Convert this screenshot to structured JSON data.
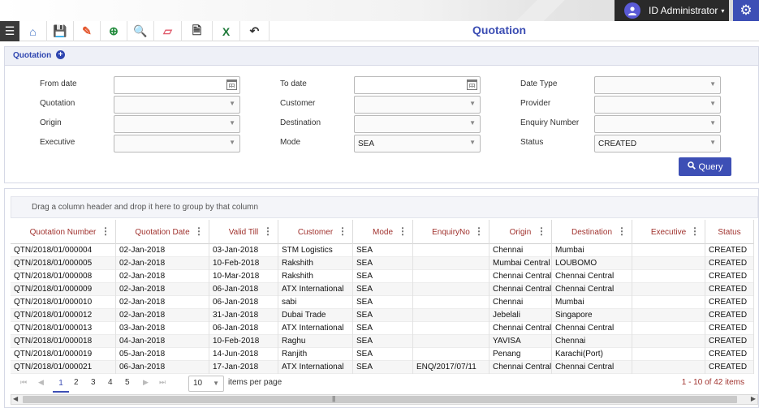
{
  "header": {
    "user_name": "ID Administrator",
    "user_caret": "▾",
    "user_avatar_icon": "user-avatar-icon",
    "settings_icon": "gear-icon"
  },
  "toolbar": {
    "menu_icon": "hamburger-menu-icon",
    "buttons": [
      {
        "icon": "home-icon",
        "glyph": "⌂",
        "color": "#3d6fc4"
      },
      {
        "icon": "save-icon",
        "glyph": "💾",
        "color": "#3d4fb5"
      },
      {
        "icon": "edit-icon",
        "glyph": "✎",
        "color": "#e4572e"
      },
      {
        "icon": "add-icon",
        "glyph": "⊕",
        "color": "#1f8a3a"
      },
      {
        "icon": "search-icon",
        "glyph": "🔍",
        "color": "#222222"
      },
      {
        "icon": "eraser-icon",
        "glyph": "▱",
        "color": "#e05a6b"
      },
      {
        "icon": "document-icon",
        "glyph": "🗎",
        "color": "#333333"
      },
      {
        "icon": "excel-icon",
        "glyph": "X",
        "color": "#1f7a3a"
      },
      {
        "icon": "undo-icon",
        "glyph": "↶",
        "color": "#333333"
      }
    ],
    "page_title": "Quotation"
  },
  "filter": {
    "section_title": "Quotation",
    "expand_glyph": "+",
    "fields": {
      "from_date_label": "From date",
      "to_date_label": "To date",
      "date_type_label": "Date Type",
      "quotation_label": "Quotation",
      "customer_label": "Customer",
      "provider_label": "Provider",
      "origin_label": "Origin",
      "destination_label": "Destination",
      "enquiry_number_label": "Enquiry Number",
      "executive_label": "Executive",
      "mode_label": "Mode",
      "mode_value": "SEA",
      "status_label": "Status",
      "status_value": "CREATED"
    },
    "query_button": "Query"
  },
  "grid": {
    "group_hint": "Drag a column header and drop it here to group by that column",
    "columns": [
      "Quotation Number",
      "Quotation Date",
      "Valid Till",
      "Customer",
      "Mode",
      "EnquiryNo",
      "Origin",
      "Destination",
      "Executive",
      "Status"
    ],
    "rows": [
      [
        "QTN/2018/01/000004",
        "02-Jan-2018",
        "03-Jan-2018",
        "STM Logistics",
        "SEA",
        "",
        "Chennai",
        "Mumbai",
        "",
        "CREATED"
      ],
      [
        "QTN/2018/01/000005",
        "02-Jan-2018",
        "10-Feb-2018",
        "Rakshith",
        "SEA",
        "",
        "Mumbai Central",
        "LOUBOMO",
        "",
        "CREATED"
      ],
      [
        "QTN/2018/01/000008",
        "02-Jan-2018",
        "10-Mar-2018",
        "Rakshith",
        "SEA",
        "",
        "Chennai Central",
        "Chennai Central",
        "",
        "CREATED"
      ],
      [
        "QTN/2018/01/000009",
        "02-Jan-2018",
        "06-Jan-2018",
        "ATX International",
        "SEA",
        "",
        "Chennai Central",
        "Chennai Central",
        "",
        "CREATED"
      ],
      [
        "QTN/2018/01/000010",
        "02-Jan-2018",
        "06-Jan-2018",
        "sabi",
        "SEA",
        "",
        "Chennai",
        "Mumbai",
        "",
        "CREATED"
      ],
      [
        "QTN/2018/01/000012",
        "02-Jan-2018",
        "31-Jan-2018",
        "Dubai Trade",
        "SEA",
        "",
        "Jebelali",
        "Singapore",
        "",
        "CREATED"
      ],
      [
        "QTN/2018/01/000013",
        "03-Jan-2018",
        "06-Jan-2018",
        "ATX International",
        "SEA",
        "",
        "Chennai Central",
        "Chennai Central",
        "",
        "CREATED"
      ],
      [
        "QTN/2018/01/000018",
        "04-Jan-2018",
        "10-Feb-2018",
        "Raghu",
        "SEA",
        "",
        "YAVISA",
        "Chennai",
        "",
        "CREATED"
      ],
      [
        "QTN/2018/01/000019",
        "05-Jan-2018",
        "14-Jun-2018",
        "Ranjith",
        "SEA",
        "",
        "Penang",
        "Karachi(Port)",
        "",
        "CREATED"
      ],
      [
        "QTN/2018/01/000021",
        "06-Jan-2018",
        "17-Jan-2018",
        "ATX International",
        "SEA",
        "ENQ/2017/07/11",
        "Chennai Central",
        "Chennai Central",
        "",
        "CREATED"
      ]
    ]
  },
  "pager": {
    "first": "⏮",
    "prev": "◀",
    "pages": [
      "1",
      "2",
      "3",
      "4",
      "5"
    ],
    "current_page": "1",
    "next": "▶",
    "last": "⏭",
    "per_page": "10",
    "per_page_label": "items per page",
    "info": "1 - 10 of 42 items"
  }
}
